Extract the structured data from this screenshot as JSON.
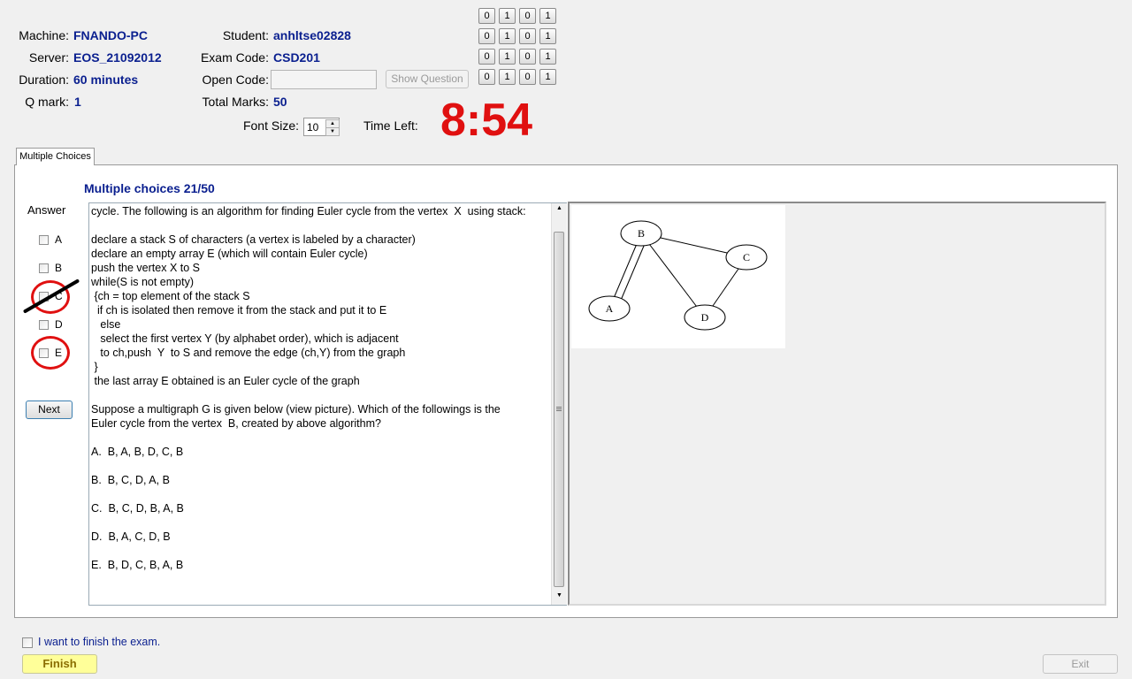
{
  "header": {
    "machine_label": "Machine:",
    "machine_value": "FNANDO-PC",
    "server_label": "Server:",
    "server_value": "EOS_21092012",
    "duration_label": "Duration:",
    "duration_value": "60 minutes",
    "qmark_label": "Q mark:",
    "qmark_value": "1",
    "student_label": "Student:",
    "student_value": "anhltse02828",
    "examcode_label": "Exam Code:",
    "examcode_value": "CSD201",
    "opencode_label": "Open Code:",
    "opencode_value": "",
    "totalmarks_label": "Total Marks:",
    "totalmarks_value": "50",
    "show_question_label": "Show Question",
    "font_size_label": "Font Size:",
    "font_size_value": "10",
    "time_left_label": "Time Left:",
    "time_left_value": "8:54"
  },
  "bit_grid": [
    [
      "0",
      "1",
      "0",
      "1"
    ],
    [
      "0",
      "1",
      "0",
      "1"
    ],
    [
      "0",
      "1",
      "0",
      "1"
    ],
    [
      "0",
      "1",
      "0",
      "1"
    ]
  ],
  "tab": {
    "label": "Multiple Choices"
  },
  "question": {
    "heading": "Multiple choices 21/50",
    "answer_label": "Answer",
    "options": [
      "A",
      "B",
      "C",
      "D",
      "E"
    ],
    "next_label": "Next",
    "lines": [
      "cycle. The following is an algorithm for finding Euler cycle from the vertex  X  using stack:",
      "",
      "declare a stack S of characters (a vertex is labeled by a character)",
      "declare an empty array E (which will contain Euler cycle)",
      "push the vertex X to S",
      "while(S is not empty)",
      " {ch = top element of the stack S",
      "  if ch is isolated then remove it from the stack and put it to E",
      "   else",
      "   select the first vertex Y (by alphabet order), which is adjacent",
      "   to ch,push  Y  to S and remove the edge (ch,Y) from the graph",
      " }",
      " the last array E obtained is an Euler cycle of the graph",
      "",
      "Suppose a multigraph G is given below (view picture). Which of the followings is the",
      "Euler cycle from the vertex  B, created by above algorithm?",
      "",
      "A.  B, A, B, D, C, B",
      "",
      "B.  B, C, D, A, B",
      "",
      "C.  B, C, D, B, A, B",
      "",
      "D.  B, A, C, D, B",
      "",
      "E.  B, D, C, B, A, B"
    ]
  },
  "graph": {
    "nodes": [
      "A",
      "B",
      "C",
      "D"
    ],
    "edges": [
      [
        "A",
        "B"
      ],
      [
        "A",
        "B"
      ],
      [
        "B",
        "C"
      ],
      [
        "B",
        "D"
      ],
      [
        "C",
        "D"
      ]
    ]
  },
  "footer": {
    "finish_check_label": "I want to finish the exam.",
    "finish_label": "Finish",
    "exit_label": "Exit"
  },
  "colors": {
    "value_blue": "#0a1f8f",
    "timer_red": "#e01010",
    "finish_yellow": "#ffff99"
  }
}
